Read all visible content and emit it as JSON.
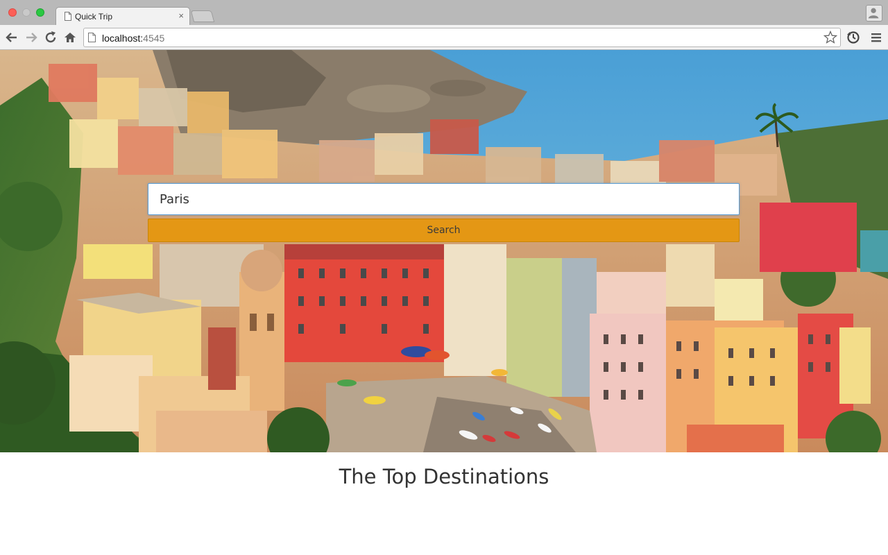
{
  "browser": {
    "tab_title": "Quick Trip",
    "tab_close": "×",
    "url_host": "localhost:",
    "url_port": "4545"
  },
  "search": {
    "value": "Paris",
    "button_label": "Search"
  },
  "section": {
    "title": "The Top Destinations"
  },
  "colors": {
    "search_button": "#e6960a",
    "input_border": "#5b9fd6"
  }
}
